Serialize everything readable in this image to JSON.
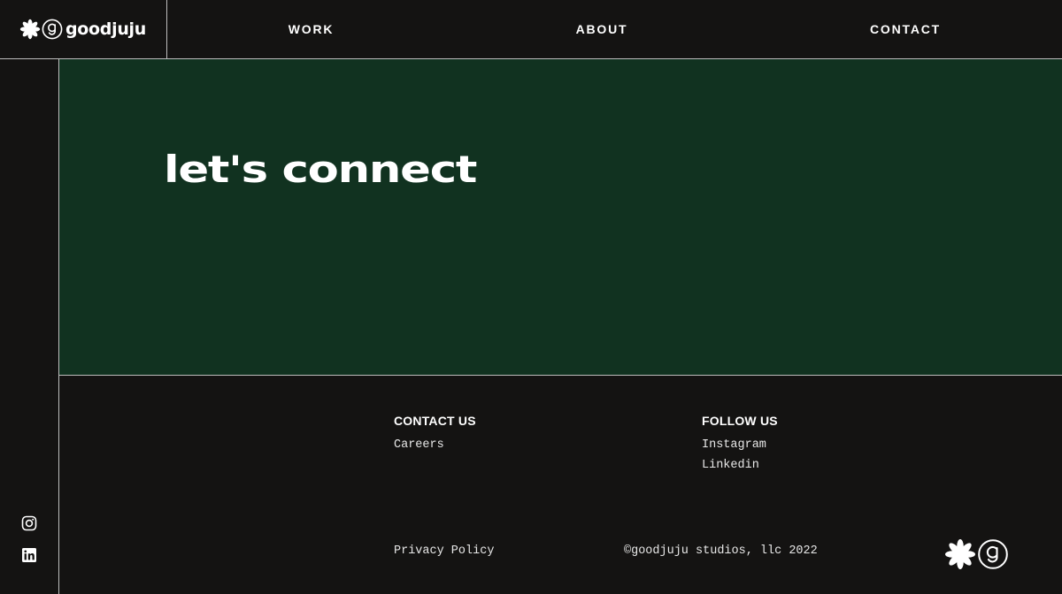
{
  "brand": {
    "name": "goodjuju",
    "icon_flower": "flower-icon",
    "icon_mark": "g-circle-icon"
  },
  "nav": {
    "items": [
      {
        "label": "WORK"
      },
      {
        "label": "ABOUT"
      },
      {
        "label": "CONTACT"
      }
    ]
  },
  "sidebar": {
    "social": [
      {
        "icon": "instagram-icon"
      },
      {
        "icon": "linkedin-icon"
      }
    ]
  },
  "hero": {
    "title": "let's connect",
    "background": "#113220"
  },
  "footer": {
    "contact_heading": "CONTACT US",
    "contact_links": [
      "Careers"
    ],
    "follow_heading": "FOLLOW US",
    "follow_links": [
      "Instagram",
      "Linkedin"
    ],
    "privacy_label": "Privacy Policy",
    "copyright": "©goodjuju studios, llc 2022"
  },
  "colors": {
    "page_background": "#141312",
    "hero_green": "#113220",
    "divider": "#bdbdbd",
    "text": "#ffffff"
  }
}
